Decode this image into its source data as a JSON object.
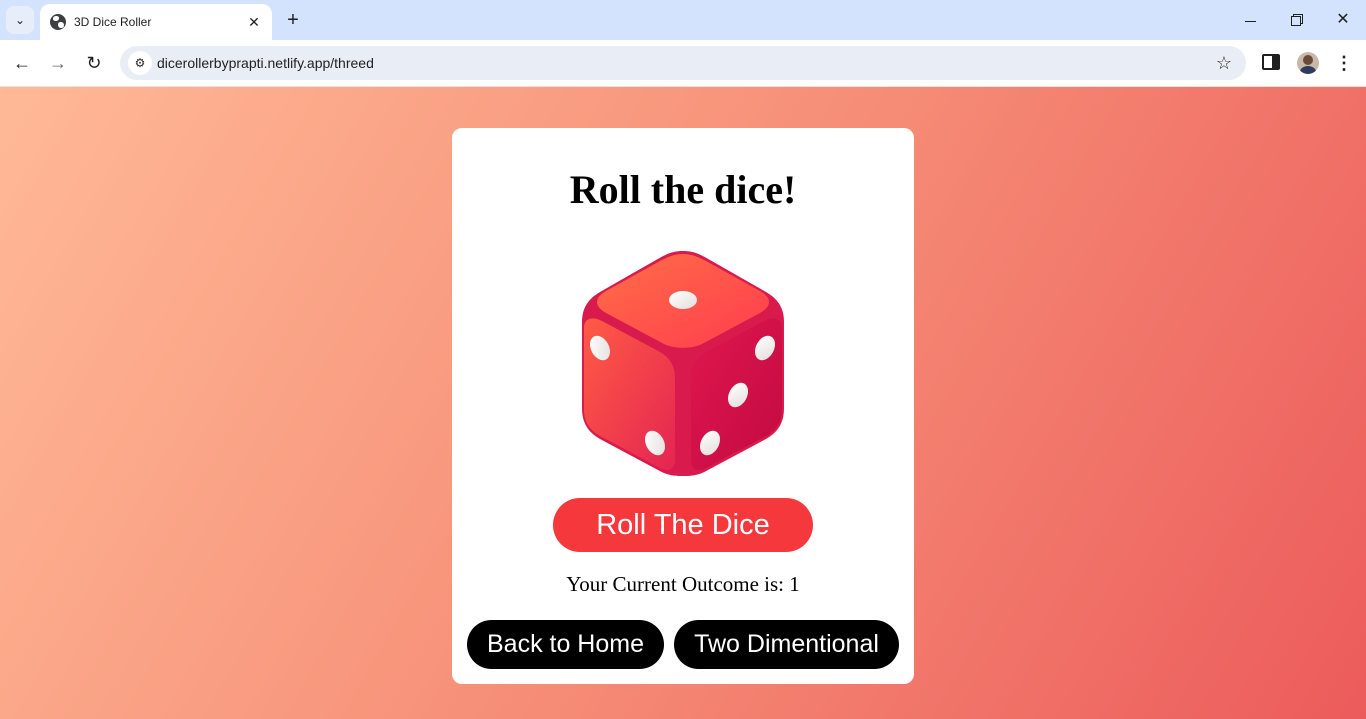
{
  "browser": {
    "tab_title": "3D Dice Roller",
    "tab_close": "✕",
    "new_tab": "+",
    "url": "dicerollerbyprapti.netlify.app/threed"
  },
  "icons": {
    "tab_search": "chevron-down-icon",
    "favicon": "globe-icon",
    "back": "arrow-left-icon",
    "forward": "arrow-right-icon",
    "reload": "reload-icon",
    "site_info": "tune-icon",
    "bookmark": "star-icon",
    "side_panel": "side-panel-icon",
    "profile": "avatar",
    "menu": "more-vertical-icon"
  },
  "page": {
    "title": "Roll the dice!",
    "roll_button": "Roll The Dice",
    "outcome_text": "Your Current Outcome is: 1",
    "back_home_button": "Back to Home",
    "two_dimensional_button": "Two Dimentional"
  },
  "colors": {
    "background_start": "#ffb996",
    "background_end": "#ec5b5b",
    "roll_button": "#f5383c",
    "nav_buttons": "#000000",
    "dice_top": "#ff6a4d",
    "dice_side": "#d8134a"
  },
  "dice": {
    "top_face_pips": 1,
    "left_face_pips": 2,
    "right_face_pips": 3
  }
}
